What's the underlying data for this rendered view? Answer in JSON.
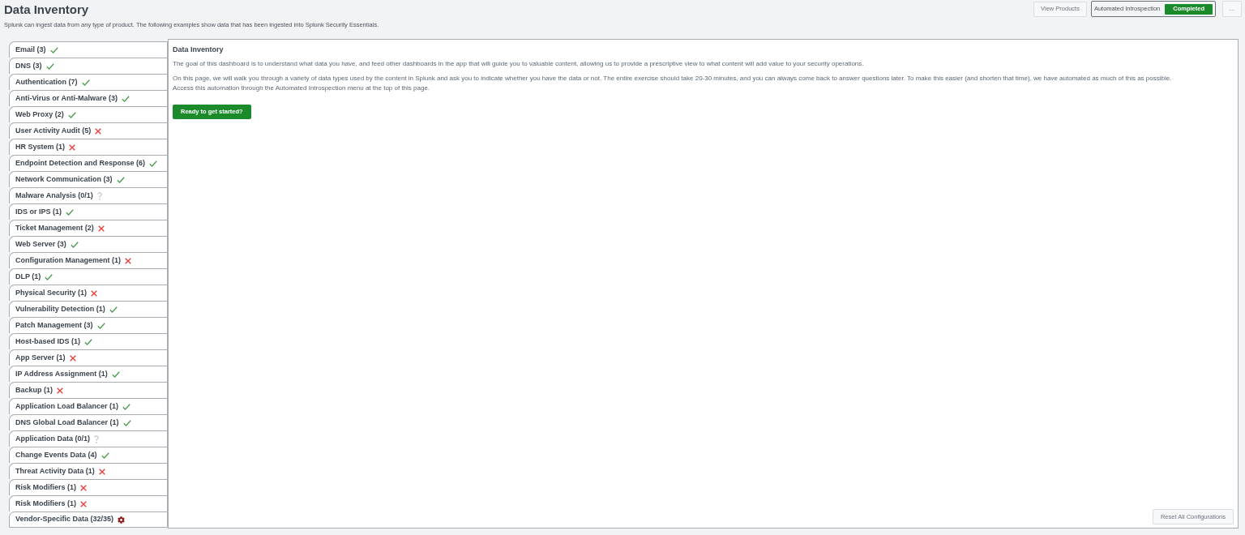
{
  "header": {
    "title": "Data Inventory",
    "subtitle": "Splunk can ingest data from any type of product. The following examples show data that has been ingested into Splunk Security Essentials."
  },
  "toolbar": {
    "view_products": "View Products",
    "introspection": {
      "label": "Automated Introspection",
      "status": "Completed"
    },
    "more": "..."
  },
  "sidebar": {
    "items": [
      {
        "label": "Email (3)",
        "kind": "check",
        "selected": false
      },
      {
        "label": "DNS (3)",
        "kind": "check",
        "selected": false
      },
      {
        "label": "Authentication (7)",
        "kind": "check",
        "selected": false
      },
      {
        "label": "Anti-Virus or Anti-Malware (3)",
        "kind": "check",
        "selected": false
      },
      {
        "label": "Web Proxy (2)",
        "kind": "check",
        "selected": false
      },
      {
        "label": "User Activity Audit (5)",
        "kind": "cross",
        "selected": false
      },
      {
        "label": "HR System (1)",
        "kind": "cross",
        "selected": false
      },
      {
        "label": "Endpoint Detection and Response (6)",
        "kind": "check",
        "selected": false
      },
      {
        "label": "Network Communication (3)",
        "kind": "check",
        "selected": false
      },
      {
        "label": "Malware Analysis (0/1)",
        "kind": "question",
        "selected": false
      },
      {
        "label": "IDS or IPS (1)",
        "kind": "check",
        "selected": false
      },
      {
        "label": "Ticket Management (2)",
        "kind": "cross",
        "selected": false
      },
      {
        "label": "Web Server (3)",
        "kind": "check",
        "selected": false
      },
      {
        "label": "Configuration Management (1)",
        "kind": "cross",
        "selected": false
      },
      {
        "label": "DLP (1)",
        "kind": "check",
        "selected": false
      },
      {
        "label": "Physical Security (1)",
        "kind": "cross",
        "selected": false
      },
      {
        "label": "Vulnerability Detection (1)",
        "kind": "check",
        "selected": false
      },
      {
        "label": "Patch Management (3)",
        "kind": "check",
        "selected": false
      },
      {
        "label": "Host-based IDS (1)",
        "kind": "check",
        "selected": false
      },
      {
        "label": "App Server (1)",
        "kind": "cross",
        "selected": false
      },
      {
        "label": "IP Address Assignment (1)",
        "kind": "check",
        "selected": false
      },
      {
        "label": "Backup (1)",
        "kind": "cross",
        "selected": false
      },
      {
        "label": "Application Load Balancer (1)",
        "kind": "check",
        "selected": false
      },
      {
        "label": "DNS Global Load Balancer (1)",
        "kind": "check",
        "selected": false
      },
      {
        "label": "Application Data (0/1)",
        "kind": "question",
        "selected": false
      },
      {
        "label": "Change Events Data (4)",
        "kind": "check",
        "selected": false
      },
      {
        "label": "Threat Activity Data (1)",
        "kind": "cross",
        "selected": false
      },
      {
        "label": "Risk Modifiers (1)",
        "kind": "cross",
        "selected": false
      },
      {
        "label": "Risk Modifiers (1)",
        "kind": "cross",
        "selected": false
      },
      {
        "label": "Vendor-Specific Data (32/35)",
        "kind": "gear",
        "selected": false
      }
    ]
  },
  "panel": {
    "title": "Data Inventory",
    "paragraphs": [
      {
        "lines": [
          "The goal of this dashboard is to understand what data you have, and feed other dashboards in the app that will guide you to valuable content, allowing us to provide a prescriptive view to what content will add value to your security operations."
        ]
      },
      {
        "lines": [
          "On this page, we will walk you through a variety of data types used by the content in Splunk and ask you to indicate whether you have the data or not. The entire exercise should take 20-30 minutes, and you can always come back to answer questions later. To make this easier (and shorten that time), we have automated as much of this as possible.",
          "Access this automation through the Automated Introspection menu at the top of this page."
        ]
      }
    ],
    "start_button": "Ready to get started?",
    "reset_button": "Reset All Configurations"
  }
}
